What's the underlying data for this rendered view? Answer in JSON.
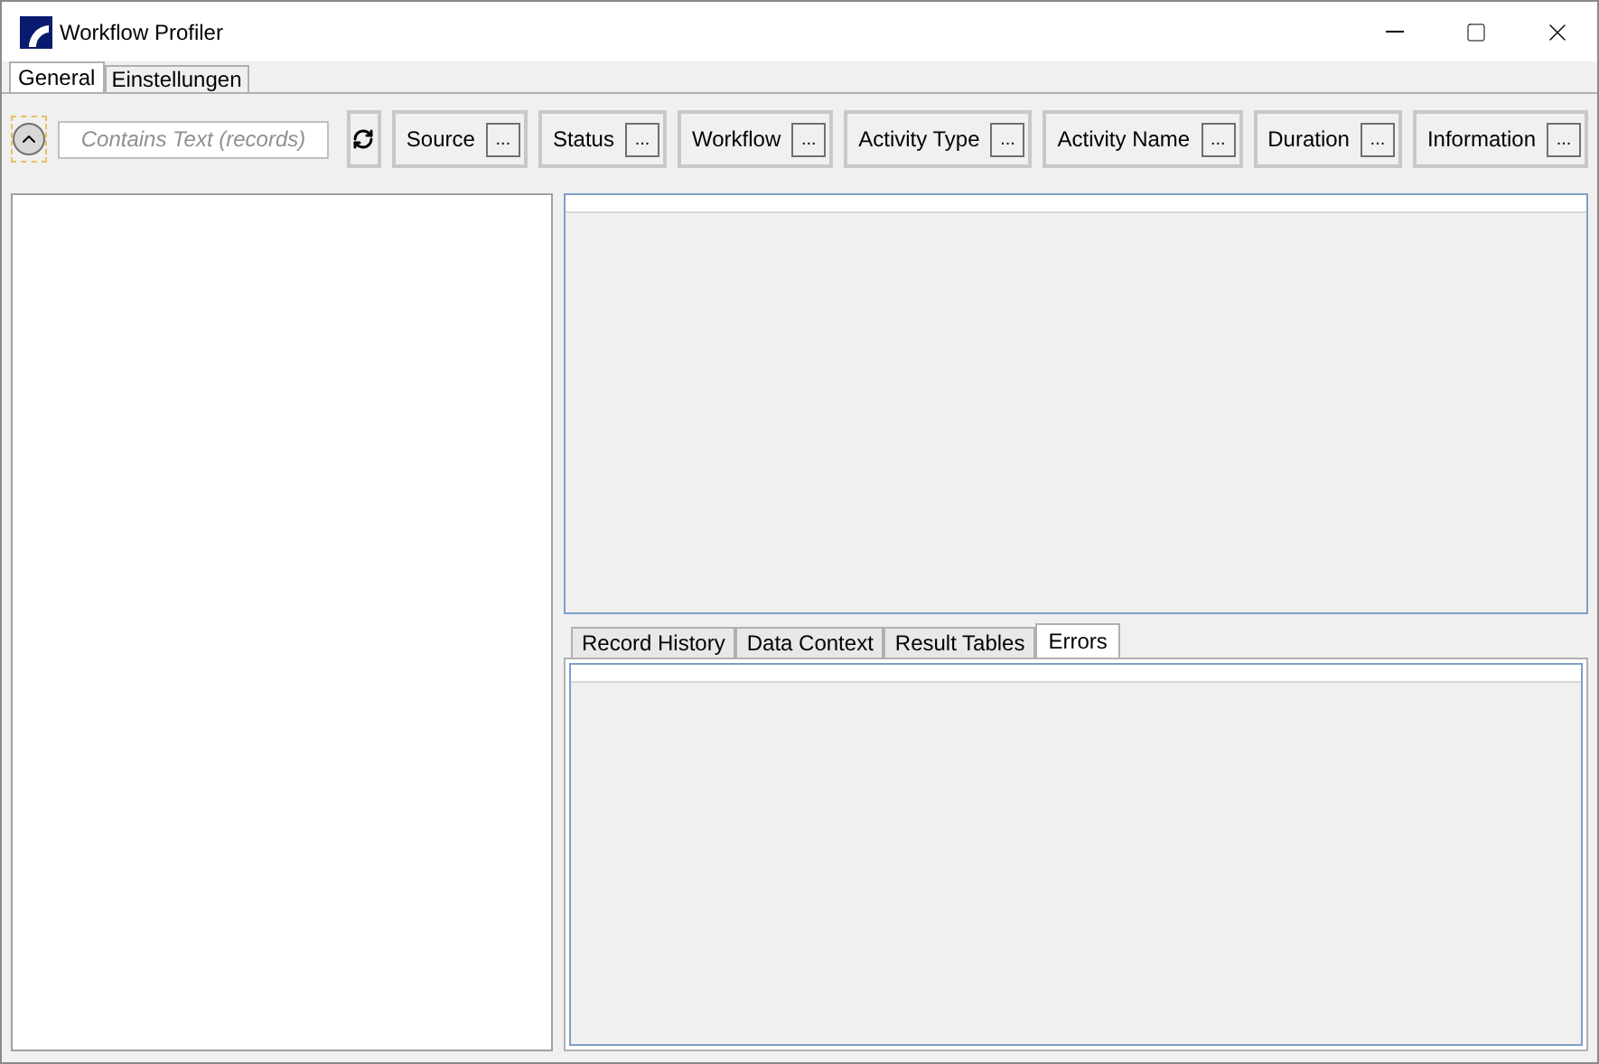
{
  "window": {
    "title": "Workflow Profiler"
  },
  "tabs": [
    {
      "label": "General",
      "selected": true
    },
    {
      "label": "Einstellungen",
      "selected": false
    }
  ],
  "search": {
    "placeholder": "Contains Text (records)"
  },
  "filters": [
    {
      "label": "Source",
      "button": "..."
    },
    {
      "label": "Status",
      "button": "..."
    },
    {
      "label": "Workflow",
      "button": "..."
    },
    {
      "label": "Activity Type",
      "button": "..."
    },
    {
      "label": "Activity Name",
      "button": "..."
    },
    {
      "label": "Duration",
      "button": "..."
    },
    {
      "label": "Information",
      "button": "..."
    }
  ],
  "detail_tabs": [
    {
      "label": "Record History",
      "selected": false
    },
    {
      "label": "Data Context",
      "selected": false
    },
    {
      "label": "Result Tables",
      "selected": false
    },
    {
      "label": "Errors",
      "selected": true
    }
  ]
}
